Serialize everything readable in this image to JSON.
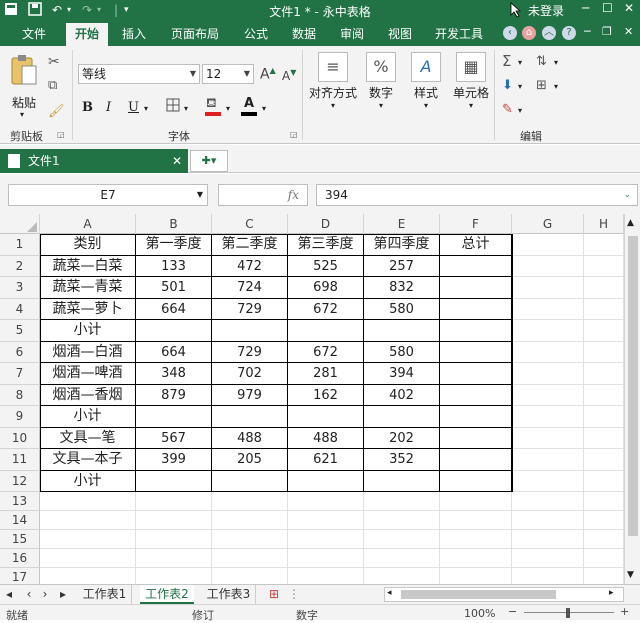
{
  "titlebar": {
    "title": "文件1 * - 永中表格",
    "login": "未登录"
  },
  "menu": {
    "file": "文件",
    "tabs": [
      "开始",
      "插入",
      "页面布局",
      "公式",
      "数据",
      "审阅",
      "视图",
      "开发工具"
    ]
  },
  "ribbon": {
    "clipboard": {
      "paste": "粘贴",
      "group": "剪贴板"
    },
    "font": {
      "name": "等线",
      "size": "12",
      "bold": "B",
      "italic": "I",
      "underline": "U",
      "color_a": "A",
      "group": "字体"
    },
    "alignment": "对齐方式",
    "number": "数字",
    "styles": "样式",
    "cells": "单元格",
    "editing": "编辑"
  },
  "doc_tab": {
    "label": "文件1"
  },
  "formula_bar": {
    "name_box": "E7",
    "fx": "fx",
    "value": "394"
  },
  "sheet": {
    "columns": [
      "A",
      "B",
      "C",
      "D",
      "E",
      "F",
      "G",
      "H"
    ],
    "rows": [
      {
        "num": "1",
        "cells": [
          "类别",
          "第一季度",
          "第二季度",
          "第三季度",
          "第四季度",
          "总计"
        ]
      },
      {
        "num": "2",
        "cells": [
          "蔬菜—白菜",
          "133",
          "472",
          "525",
          "257",
          ""
        ]
      },
      {
        "num": "3",
        "cells": [
          "蔬菜—青菜",
          "501",
          "724",
          "698",
          "832",
          ""
        ]
      },
      {
        "num": "4",
        "cells": [
          "蔬菜—萝卜",
          "664",
          "729",
          "672",
          "580",
          ""
        ]
      },
      {
        "num": "5",
        "cells": [
          "小计",
          "",
          "",
          "",
          "",
          ""
        ]
      },
      {
        "num": "6",
        "cells": [
          "烟酒—白酒",
          "664",
          "729",
          "672",
          "580",
          ""
        ]
      },
      {
        "num": "7",
        "cells": [
          "烟酒—啤酒",
          "348",
          "702",
          "281",
          "394",
          ""
        ]
      },
      {
        "num": "8",
        "cells": [
          "烟酒—香烟",
          "879",
          "979",
          "162",
          "402",
          ""
        ]
      },
      {
        "num": "9",
        "cells": [
          "小计",
          "",
          "",
          "",
          "",
          ""
        ]
      },
      {
        "num": "10",
        "cells": [
          "文具—笔",
          "567",
          "488",
          "488",
          "202",
          ""
        ]
      },
      {
        "num": "11",
        "cells": [
          "文具—本子",
          "399",
          "205",
          "621",
          "352",
          ""
        ]
      },
      {
        "num": "12",
        "cells": [
          "小计",
          "",
          "",
          "",
          "",
          ""
        ]
      },
      {
        "num": "13",
        "cells": [
          "",
          "",
          "",
          "",
          "",
          ""
        ]
      },
      {
        "num": "14",
        "cells": [
          "",
          "",
          "",
          "",
          "",
          ""
        ]
      },
      {
        "num": "15",
        "cells": [
          "",
          "",
          "",
          "",
          "",
          ""
        ]
      },
      {
        "num": "16",
        "cells": [
          "",
          "",
          "",
          "",
          "",
          ""
        ]
      },
      {
        "num": "17",
        "cells": [
          "",
          "",
          "",
          "",
          "",
          ""
        ]
      }
    ]
  },
  "sheet_tabs": [
    "工作表1",
    "工作表2",
    "工作表3"
  ],
  "active_sheet": "工作表2",
  "status": {
    "ready": "就绪",
    "edit": "修订",
    "num": "数字",
    "zoom": "100%"
  },
  "colors": {
    "brand": "#217346",
    "ribbon_bg": "#f3f3f3"
  }
}
